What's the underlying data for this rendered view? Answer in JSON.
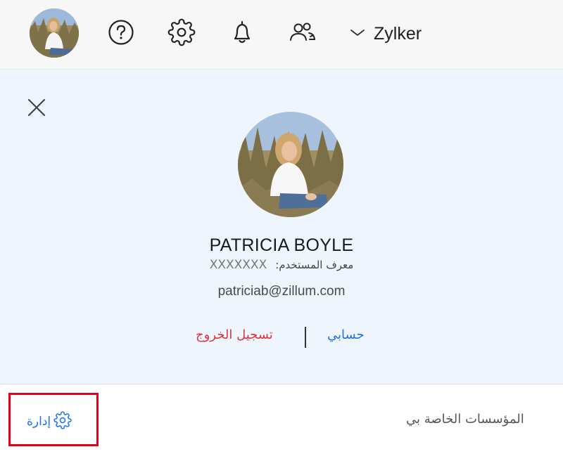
{
  "topbar": {
    "icons": [
      "user-avatar",
      "help-icon",
      "gear-icon",
      "bell-icon",
      "users-icon"
    ],
    "org_name": "Zylker"
  },
  "panel": {
    "user_name": "PATRICIA BOYLE",
    "user_id_label": "معرف المستخدم:",
    "user_id_value": "XXXXXXX",
    "email": "patriciab@zillum.com",
    "sign_out": "تسجيل الخروج",
    "my_account": "حسابي"
  },
  "footer": {
    "my_orgs_label": "المؤسسات الخاصة بي",
    "manage_label": "إدارة"
  },
  "colors": {
    "accent": "#1a73e8",
    "danger": "#e0343d",
    "highlight": "#e2001a",
    "panel_bg": "#eef5fd"
  }
}
